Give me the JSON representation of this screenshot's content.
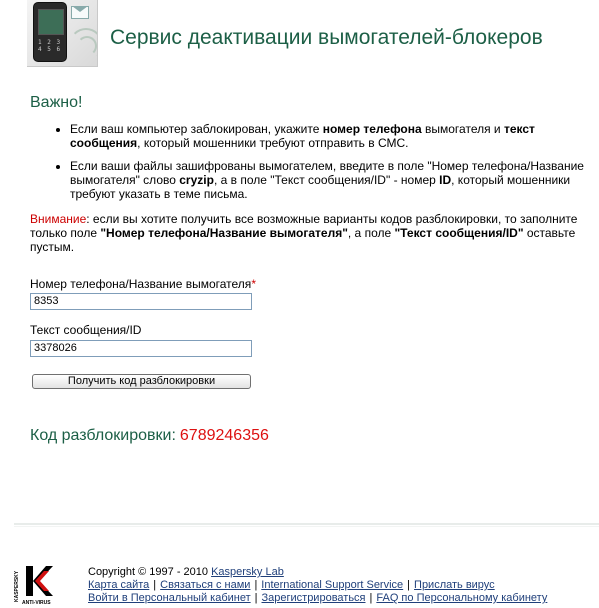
{
  "header": {
    "title": "Сервис деактивации вымогателей-блокеров",
    "logo_keys": "1 2 3 4 5 6"
  },
  "important_heading": "Важно!",
  "instructions": {
    "item1": {
      "p1": "Если ваш компьютер заблокирован, укажите ",
      "b1": "номер телефона",
      "p2": " вымогателя и ",
      "b2": "текст сообщения",
      "p3": ", который мошенники требуют отправить в СМС."
    },
    "item2": {
      "p1": "Если ваши файлы зашифрованы вымогателем, введите в поле \"Номер телефона/Название вымогателя\" слово ",
      "b1": "cryzip",
      "p2": ", а в поле \"Текст сообщения/ID\" - номер ",
      "b2": "ID",
      "p3": ", который мошенники требуют указать в теме письма."
    }
  },
  "warning": {
    "label": "Внимание",
    "p1": ": если вы хотите получить все возможные варианты кодов разблокировки, то заполните только поле ",
    "b1": "\"Номер телефона/Название вымогателя\"",
    "p2": ", а поле ",
    "b2": "\"Текст сообщения/ID\"",
    "p3": " оставьте пустым."
  },
  "form": {
    "phone_label": "Номер телефона/Название вымогателя",
    "required_mark": "*",
    "phone_value": "8353",
    "message_label": "Текст сообщения/ID",
    "message_value": "3378026",
    "submit_label": "Получить код разблокировки"
  },
  "result": {
    "label": "Код разблокировки:",
    "code": "6789246356"
  },
  "footer": {
    "copyright": "Copyright © 1997 - 2010",
    "company_link": "Kaspersky Lab",
    "row1": [
      "Карта сайта",
      "Связаться с нами",
      "International Support Service",
      "Прислать вирус"
    ],
    "row2": [
      "Войти в Персональный кабинет",
      "Зарегистрироваться",
      "FAQ по Персональному кабинету"
    ],
    "separator": "|",
    "logo_vertical": "KASPERSKY",
    "logo_bottom": "ANTI-VIRUS"
  },
  "colors": {
    "heading_green": "#1c5f46",
    "warning_red": "#cc0000",
    "code_red": "#dd1111",
    "link_blue": "#1f3f7a"
  }
}
